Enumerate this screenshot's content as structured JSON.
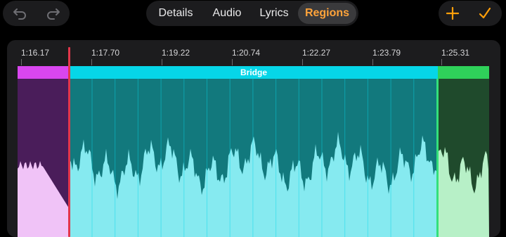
{
  "toolbar": {
    "undo_icon": "undo-arrow-icon",
    "redo_icon": "redo-arrow-icon",
    "add_icon": "plus-icon",
    "confirm_icon": "checkmark-icon",
    "accent_color": "#ff9f0a"
  },
  "tabs": [
    {
      "label": "Details",
      "active": false
    },
    {
      "label": "Audio",
      "active": false
    },
    {
      "label": "Lyrics",
      "active": false
    },
    {
      "label": "Regions",
      "active": true
    }
  ],
  "timeline": {
    "ticks": [
      "1:16.17",
      "1:17.70",
      "1:19.22",
      "1:20.74",
      "1:22.27",
      "1:23.79",
      "1:25.31"
    ]
  },
  "regions": [
    {
      "label": "",
      "color": "#d946ef",
      "dark": "#4a1d5a",
      "light": "#f0c3f7"
    },
    {
      "label": "Bridge",
      "color": "#06d6e8",
      "dark": "#12797d",
      "light": "#86eaf0"
    },
    {
      "label": "",
      "color": "#2fd15a",
      "dark": "#1f4a2c",
      "light": "#b7f0c7"
    }
  ],
  "colors": {
    "playhead": "#e2364b",
    "region_boundary": "#34e07a"
  }
}
